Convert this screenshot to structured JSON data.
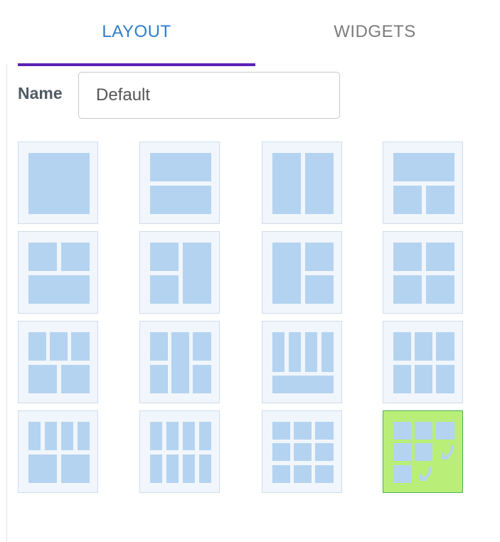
{
  "tabs": {
    "layout_label": "LAYOUT",
    "widgets_label": "WIDGETS"
  },
  "name_field": {
    "label": "Name",
    "value": "Default"
  },
  "layout_tiles": [
    {
      "id": "single",
      "selected": false
    },
    {
      "id": "two-rows",
      "selected": false
    },
    {
      "id": "two-columns",
      "selected": false
    },
    {
      "id": "top-wide-two-bottom",
      "selected": false
    },
    {
      "id": "two-top-wide-bottom",
      "selected": false
    },
    {
      "id": "left-two-right-tall",
      "selected": false
    },
    {
      "id": "left-tall-right-two",
      "selected": false
    },
    {
      "id": "grid-2x2",
      "selected": false
    },
    {
      "id": "three-top-two-bottom",
      "selected": false
    },
    {
      "id": "two-left-tall-center-two-right",
      "selected": false
    },
    {
      "id": "four-columns-wide-bottom",
      "selected": false
    },
    {
      "id": "grid-3x2",
      "selected": false
    },
    {
      "id": "four-top-two-bottom",
      "selected": false
    },
    {
      "id": "grid-4x2",
      "selected": false
    },
    {
      "id": "grid-3x3",
      "selected": false
    },
    {
      "id": "custom-expand",
      "selected": true
    }
  ],
  "colors": {
    "tab_active": "#2f7dc9",
    "tab_indicator": "#5b21b6",
    "cell_fill": "#b4d3f0",
    "selected_tile": "#b9ef78"
  }
}
